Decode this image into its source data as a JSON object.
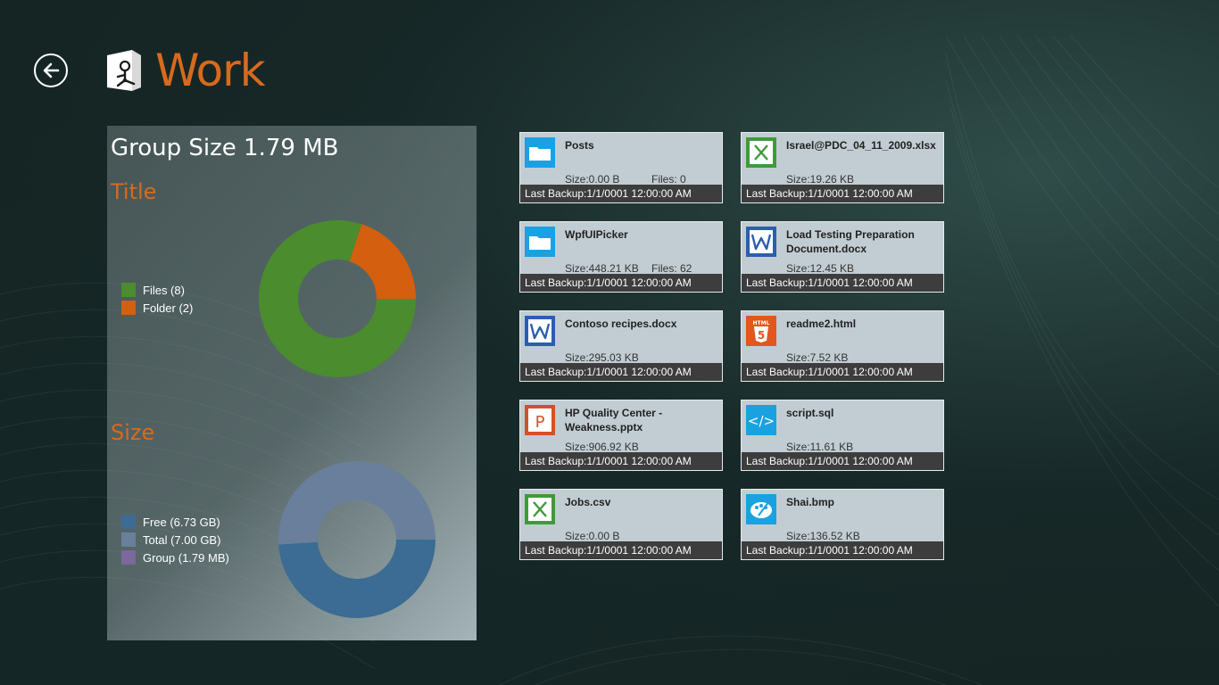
{
  "header": {
    "title": "Work"
  },
  "summary": {
    "group_size": "Group Size 1.79 MB",
    "title_section": {
      "heading": "Title",
      "legend": [
        {
          "label": "Files (8)",
          "color": "#4a8c2e"
        },
        {
          "label": "Folder (2)",
          "color": "#d35f0f"
        }
      ]
    },
    "size_section": {
      "heading": "Size",
      "legend": [
        {
          "label": "Free (6.73 GB)",
          "color": "#3c6b93"
        },
        {
          "label": "Total (7.00 GB)",
          "color": "#6a7f9b"
        },
        {
          "label": "Group (1.79 MB)",
          "color": "#7b689d"
        }
      ]
    }
  },
  "chart_data": [
    {
      "type": "pie",
      "title": "Title",
      "categories": [
        "Files (8)",
        "Folder (2)"
      ],
      "values": [
        8,
        2
      ],
      "colors": [
        "#4a8c2e",
        "#d35f0f"
      ]
    },
    {
      "type": "pie",
      "title": "Size",
      "categories": [
        "Free (6.73 GB)",
        "Total (7.00 GB)",
        "Group (1.79 MB)"
      ],
      "values": [
        6.73,
        7.0,
        0.00179
      ],
      "colors": [
        "#3c6b93",
        "#6a7f9b",
        "#7b689d"
      ]
    }
  ],
  "files": [
    {
      "name": "Posts",
      "size": "Size:0.00 B",
      "files": "Files: 0",
      "backup": "Last Backup:1/1/0001 12:00:00 AM",
      "icon": "folder-icon"
    },
    {
      "name": "Israel@PDC_04_11_2009.xlsx",
      "size": "Size:19.26 KB",
      "files": "",
      "backup": "Last Backup:1/1/0001 12:00:00 AM",
      "icon": "excel-icon"
    },
    {
      "name": "WpfUIPicker",
      "size": "Size:448.21 KB",
      "files": "Files: 62",
      "backup": "Last Backup:1/1/0001 12:00:00 AM",
      "icon": "folder-icon"
    },
    {
      "name": "Load Testing Preparation Document.docx",
      "size": "Size:12.45 KB",
      "files": "",
      "backup": "Last Backup:1/1/0001 12:00:00 AM",
      "icon": "word-icon"
    },
    {
      "name": "Contoso recipes.docx",
      "size": "Size:295.03 KB",
      "files": "",
      "backup": "Last Backup:1/1/0001 12:00:00 AM",
      "icon": "word-icon"
    },
    {
      "name": "readme2.html",
      "size": "Size:7.52 KB",
      "files": "",
      "backup": "Last Backup:1/1/0001 12:00:00 AM",
      "icon": "html5-icon"
    },
    {
      "name": "HP Quality Center - Weakness.pptx",
      "size": "Size:906.92 KB",
      "files": "",
      "backup": "Last Backup:1/1/0001 12:00:00 AM",
      "icon": "powerpoint-icon"
    },
    {
      "name": "script.sql",
      "size": "Size:11.61 KB",
      "files": "",
      "backup": "Last Backup:1/1/0001 12:00:00 AM",
      "icon": "code-icon"
    },
    {
      "name": "Jobs.csv",
      "size": "Size:0.00 B",
      "files": "",
      "backup": "Last Backup:1/1/0001 12:00:00 AM",
      "icon": "excel-icon"
    },
    {
      "name": "Shai.bmp",
      "size": "Size:136.52 KB",
      "files": "",
      "backup": "Last Backup:1/1/0001 12:00:00 AM",
      "icon": "paint-icon"
    }
  ]
}
